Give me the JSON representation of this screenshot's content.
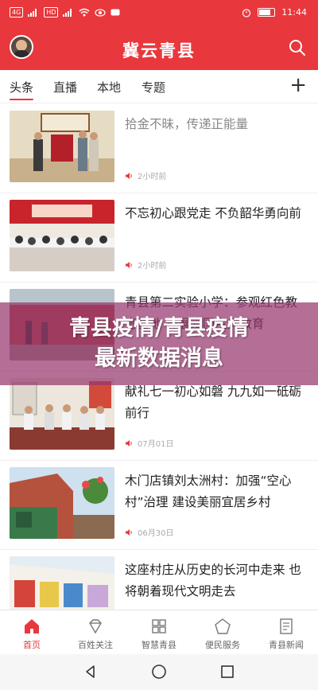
{
  "status_bar": {
    "network_left": "4G",
    "network_right": "HD",
    "time": "11:44"
  },
  "header": {
    "title": "冀云青县"
  },
  "tabs": [
    {
      "label": "头条"
    },
    {
      "label": "直播"
    },
    {
      "label": "本地"
    },
    {
      "label": "专题"
    }
  ],
  "news": [
    {
      "title": "拾金不昧，传递正能量",
      "time": "2小时前"
    },
    {
      "title": "不忘初心跟党走 不负韶华勇向前",
      "time": "2小时前"
    },
    {
      "title": "青县第二实验小学：参观红色教育基地 开展爱国主义教育",
      "time": ""
    },
    {
      "title": "献礼七一初心如磐 九九如一砥砺前行",
      "time": "07月01日"
    },
    {
      "title": "木门店镇刘太洲村：加强“空心村”治理 建设美丽宜居乡村",
      "time": "06月30日"
    },
    {
      "title": "这座村庄从历史的长河中走来 也将朝着现代文明走去",
      "time": ""
    }
  ],
  "overlay": {
    "line1": "青县疫情/青县疫情",
    "line2": "最新数据消息"
  },
  "bottom_nav": [
    {
      "label": "首页",
      "icon": "home-icon"
    },
    {
      "label": "百姓关注",
      "icon": "diamond-icon"
    },
    {
      "label": "智慧青县",
      "icon": "grid-icon"
    },
    {
      "label": "便民服务",
      "icon": "pentagon-icon"
    },
    {
      "label": "青县新闻",
      "icon": "document-icon"
    }
  ],
  "colors": {
    "brand": "#e8383d",
    "overlay": "#96376e"
  }
}
